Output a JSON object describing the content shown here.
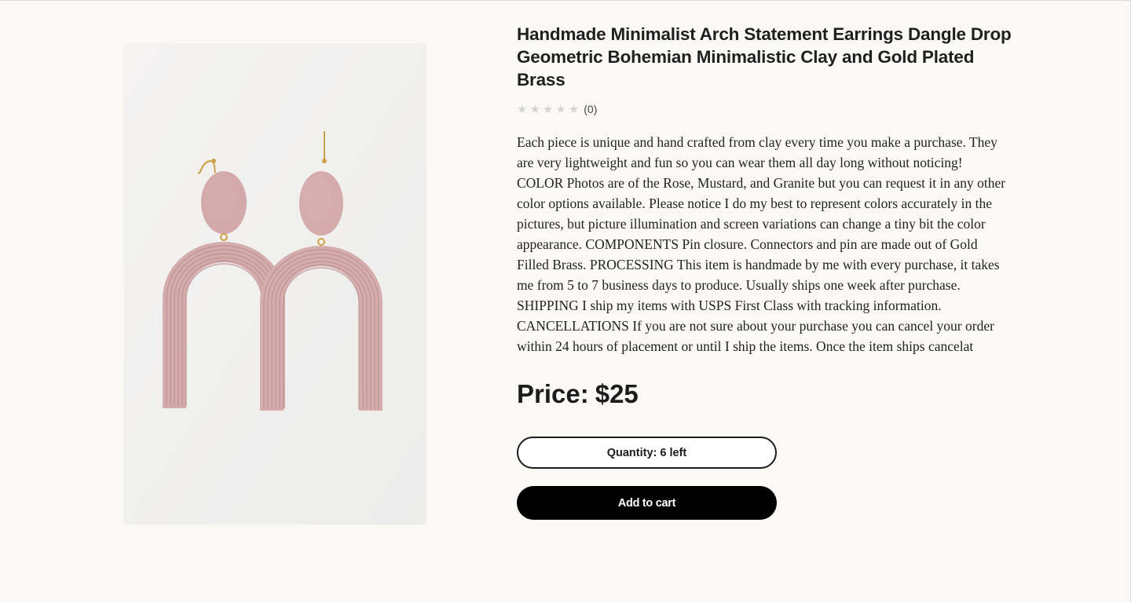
{
  "product": {
    "title": "Handmade Minimalist Arch Statement Earrings Dangle Drop Geometric Bohemian Minimalistic Clay and Gold Plated Brass",
    "rating": {
      "stars_filled": 0,
      "stars_total": 5,
      "review_count": "(0)"
    },
    "description": "Each piece is unique and hand crafted from clay every time you make a purchase. They are very lightweight and fun so you can wear them all day long without noticing! COLOR Photos are of the Rose, Mustard, and Granite but you can request it in any other color options available. Please notice I do my best to represent colors accurately in the pictures, but picture illumination and screen variations can change a tiny bit the color appearance. COMPONENTS Pin closure. Connectors and pin are made out of Gold Filled Brass. PROCESSING This item is handmade by me with every purchase, it takes me from 5 to 7 business days to produce. Usually ships one week after purchase. SHIPPING I ship my items with USPS First Class with tracking information. CANCELLATIONS If you are not sure about your purchase you can cancel your order within 24 hours of placement or until I ship the items. Once the item ships cancelat",
    "price_label": "Price:",
    "price_value": "$25",
    "quantity_label": "Quantity: 6 left",
    "add_to_cart_label": "Add to cart",
    "image_icon": "earrings-product-photo"
  },
  "colors": {
    "background": "#faf9f6",
    "clay_pink": "#d8aeae",
    "gold": "#c9a24a",
    "button_dark": "#000000"
  }
}
